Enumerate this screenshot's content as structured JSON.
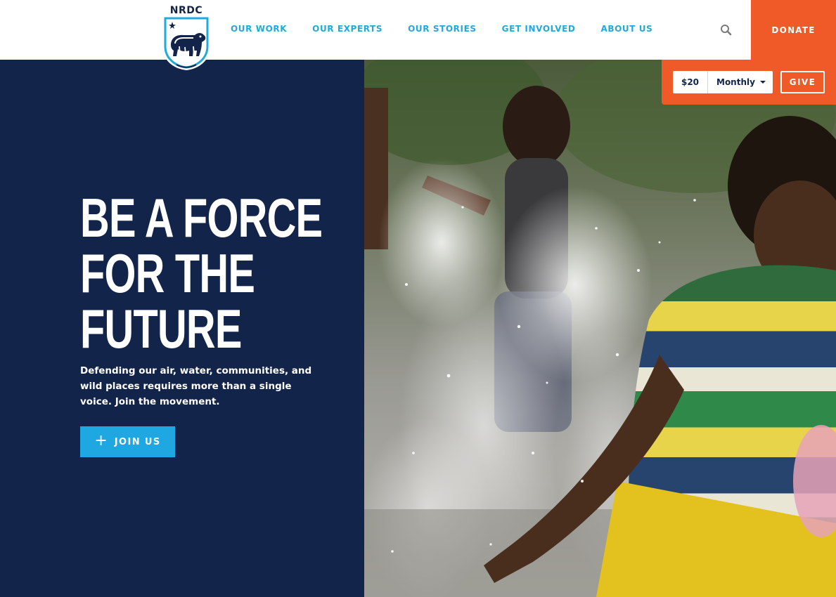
{
  "brand": {
    "name": "NRDC"
  },
  "nav": {
    "items": [
      {
        "label": "OUR WORK"
      },
      {
        "label": "OUR EXPERTS"
      },
      {
        "label": "OUR STORIES"
      },
      {
        "label": "GET INVOLVED"
      },
      {
        "label": "ABOUT US"
      }
    ],
    "search_icon": "search-icon",
    "donate_label": "DONATE"
  },
  "donate_bar": {
    "amount": "$20",
    "frequency": "Monthly",
    "give_label": "GIVE"
  },
  "hero": {
    "title_lines": [
      "BE A FORCE",
      "FOR THE",
      "FUTURE"
    ],
    "subtitle": "Defending our air, water, communities, and wild places requires more than a single voice. Join the movement.",
    "cta_label": "JOIN US",
    "cta_icon": "plus-icon"
  },
  "colors": {
    "navy": "#13244a",
    "accent_blue": "#22a9dc",
    "cta_blue": "#1ea7e1",
    "donate_orange": "#f05a28",
    "white": "#ffffff"
  }
}
